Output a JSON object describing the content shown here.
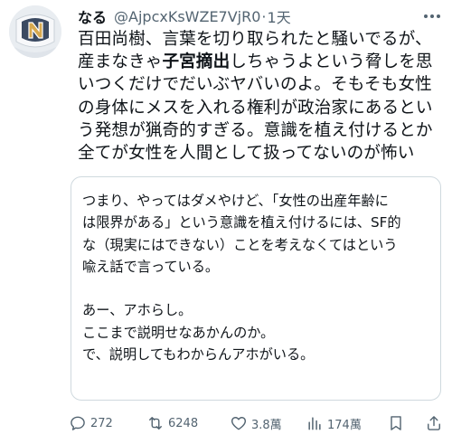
{
  "user": {
    "display_name": "なる",
    "handle": "@AjpcxKsWZE7VjR0",
    "separator": "·",
    "time": "1天",
    "avatar_letter": "N"
  },
  "tweet": {
    "lines": [
      {
        "pre": "百田尚樹、言葉を切り取られたと騒いでるが、",
        "bold": "",
        "post": ""
      },
      {
        "pre": "産まなきゃ",
        "bold": "子宮摘出",
        "post": "しちゃうよという脅しを思"
      },
      {
        "pre": "いつくだけでだいぶヤバいのよ。そもそも女性",
        "bold": "",
        "post": ""
      },
      {
        "pre": "の身体にメスを入れる権利が政治家にあるとい",
        "bold": "",
        "post": ""
      },
      {
        "pre": "う発想が猟奇的すぎる。意識を植え付けるとか",
        "bold": "",
        "post": ""
      },
      {
        "pre": "全てが女性を人間として扱ってないのが怖い",
        "bold": "",
        "post": ""
      }
    ]
  },
  "quote": {
    "lines": [
      "つまり、やってはダメやけど、「女性の出産年齢に",
      "は限界がある」という意識を植え付けるには、SF的",
      "な（現実にはできない）ことを考えなくてはという",
      "喩え話で言っている。",
      "",
      "あー、アホらし。",
      "ここまで説明せなあかんのか。",
      "で、説明してもわからんアホがいる。"
    ]
  },
  "actions": {
    "replies": "272",
    "retweets": "6248",
    "likes": "3.8萬",
    "views": "174萬"
  },
  "icons": {
    "more": "more-dots-icon",
    "reply": "reply-icon",
    "retweet": "retweet-icon",
    "like": "heart-icon",
    "views": "views-icon",
    "bookmark": "bookmark-icon",
    "share": "share-icon"
  },
  "colors": {
    "text": "#0f1419",
    "secondary": "#536471",
    "border": "#cfd9de"
  }
}
